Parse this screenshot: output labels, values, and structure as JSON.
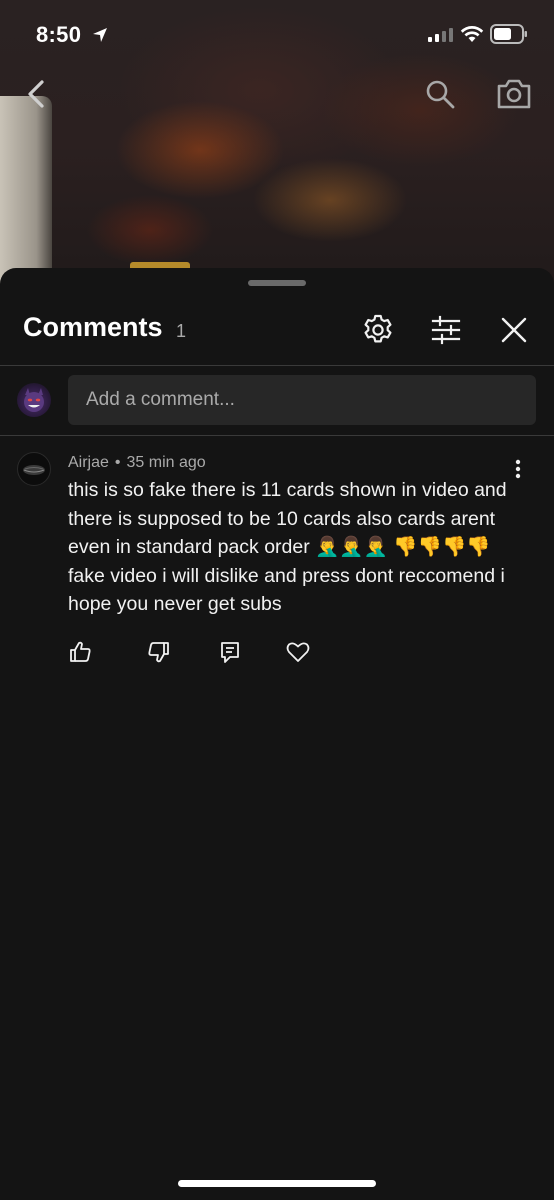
{
  "status_bar": {
    "time": "8:50"
  },
  "comments_panel": {
    "title": "Comments",
    "count": "1",
    "add_comment_placeholder": "Add a comment..."
  },
  "comments": [
    {
      "author": "Airjae",
      "separator": "•",
      "timestamp": "35 min ago",
      "text": "this is so fake there is 11 cards shown in video and there is supposed to be 10 cards also cards arent even in standard pack order 🤦‍♂️🤦‍♂️🤦‍♂️ 👎👎👎👎 fake video i will dislike and press dont reccomend i hope you never get subs"
    }
  ],
  "icons": {
    "back": "chevron-left-icon",
    "search": "search-icon",
    "camera": "camera-icon",
    "settings": "gear-icon",
    "filter": "sliders-icon",
    "close": "close-icon",
    "more": "more-vertical-icon",
    "like": "thumbs-up-icon",
    "dislike": "thumbs-down-icon",
    "reply": "reply-icon",
    "heart": "heart-icon"
  },
  "colors": {
    "sheet_background": "#141414",
    "input_background": "#272727",
    "secondary_text": "#aaaaaa"
  }
}
